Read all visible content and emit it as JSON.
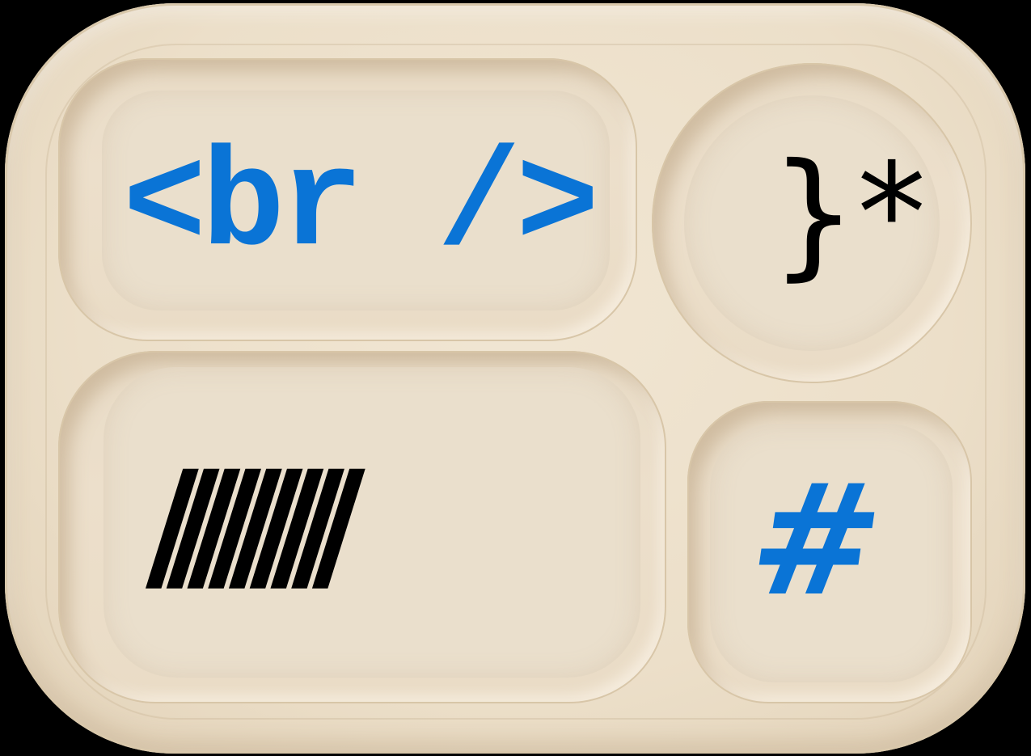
{
  "compartments": {
    "top_left": {
      "text": "<br />",
      "color": "#0a74d6"
    },
    "top_right": {
      "text": "}*",
      "color": "#000000"
    },
    "bottom_left": {
      "text": "/////////",
      "color": "#000000"
    },
    "bottom_right": {
      "text": "#",
      "color": "#0a74d6"
    }
  },
  "colors": {
    "background": "#000000",
    "tray": "#ecdfc9",
    "accent_blue": "#0a74d6"
  }
}
